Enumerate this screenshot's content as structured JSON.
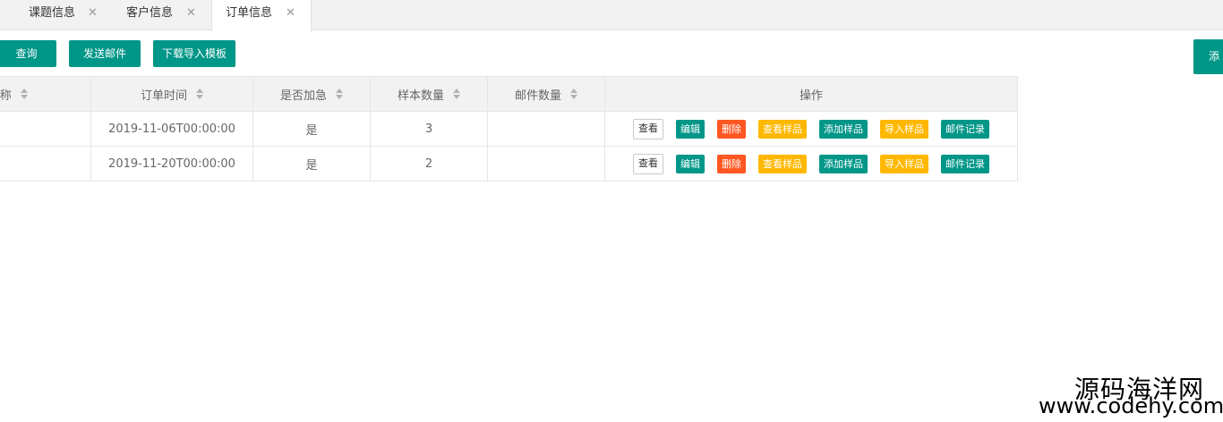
{
  "tabs": [
    {
      "label": "课题信息",
      "close": "✕"
    },
    {
      "label": "客户信息",
      "close": "✕"
    },
    {
      "label": "订单信息",
      "close": "✕"
    }
  ],
  "toolbar": {
    "query": "查询",
    "send_mail": "发送邮件",
    "download_template": "下载导入模板",
    "add": "添"
  },
  "table": {
    "headers": [
      "名称",
      "订单时间",
      "是否加急",
      "样本数量",
      "邮件数量",
      "操作"
    ],
    "rows": [
      {
        "name": "",
        "order_time": "2019-11-06T00:00:00",
        "urgent": "是",
        "samples": "3",
        "mails": ""
      },
      {
        "name": "",
        "order_time": "2019-11-20T00:00:00",
        "urgent": "是",
        "samples": "2",
        "mails": ""
      }
    ],
    "actions": {
      "view": "查看",
      "edit": "编辑",
      "delete": "删除",
      "view_samples": "查看样品",
      "add_samples": "添加样品",
      "import_samples": "导入样品",
      "mail_records": "邮件记录"
    }
  },
  "watermark": {
    "line1": "源码海洋网",
    "line2": "www.codehy.com"
  },
  "colors": {
    "primary": "#009688",
    "danger": "#ff5722",
    "warning": "#ffb800"
  }
}
